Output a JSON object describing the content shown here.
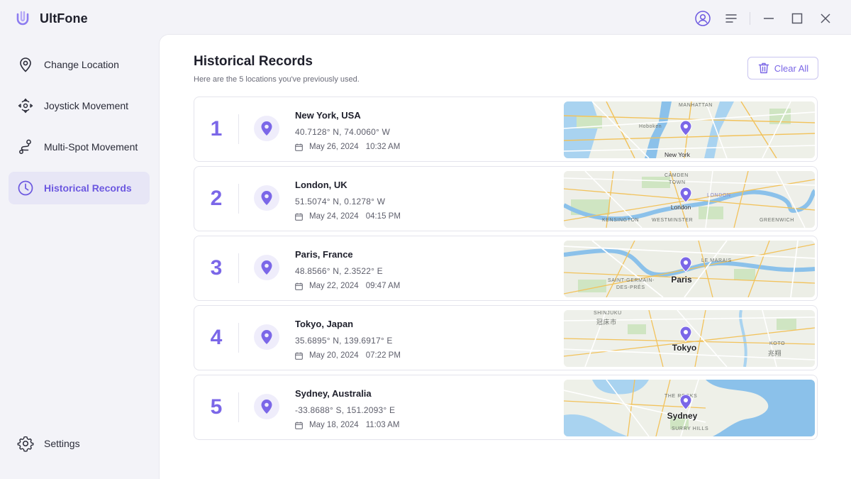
{
  "app": {
    "name": "UltFone",
    "brand_color": "#7b67e8"
  },
  "window_controls": {
    "icons": [
      "user-account-icon",
      "menu-icon",
      "minimize-icon",
      "maximize-icon",
      "close-icon"
    ]
  },
  "sidebar": {
    "items": [
      {
        "label": "Change Location",
        "icon": "location-pin-icon",
        "active": false
      },
      {
        "label": "Joystick Movement",
        "icon": "joystick-icon",
        "active": false
      },
      {
        "label": "Multi-Spot Movement",
        "icon": "route-icon",
        "active": false
      },
      {
        "label": "Historical Records",
        "icon": "clock-icon",
        "active": true
      }
    ],
    "settings_label": "Settings"
  },
  "main": {
    "title": "Historical Records",
    "subtitle": "Here are the 5 locations you've previously used.",
    "clear_all_label": "Clear All"
  },
  "records": [
    {
      "index": "1",
      "name": "New York, USA",
      "coords": "40.7128° N, 74.0060° W",
      "date": "May 26, 2024",
      "time": "10:32 AM",
      "map": {
        "city": "New York",
        "city_style": "small",
        "labels": [
          "MANHATTAN",
          "Hoboken"
        ]
      }
    },
    {
      "index": "2",
      "name": "London, UK",
      "coords": "51.5074° N, 0.1278° W",
      "date": "May 24, 2024",
      "time": "04:15 PM",
      "map": {
        "city": "London",
        "city_style": "small",
        "labels": [
          "CAMDEN",
          "TOWN",
          "LONDON",
          "KENSINGTON",
          "WESTMINSTER",
          "GREENWICH"
        ]
      }
    },
    {
      "index": "3",
      "name": "Paris, France",
      "coords": "48.8566° N, 2.3522° E",
      "date": "May 22, 2024",
      "time": "09:47 AM",
      "map": {
        "city": "Paris",
        "city_style": "large",
        "labels": [
          "LE MARAIS",
          "SAINT-GERMAIN-",
          "DES-PRÉS"
        ]
      }
    },
    {
      "index": "4",
      "name": "Tokyo, Japan",
      "coords": "35.6895° N, 139.6917° E",
      "date": "May 20, 2024",
      "time": "07:22 PM",
      "map": {
        "city": "Tokyo",
        "city_style": "large",
        "labels": [
          "SHINJUKU",
          "冠床市",
          "KOTO",
          "兆翔"
        ]
      }
    },
    {
      "index": "5",
      "name": "Sydney, Australia",
      "coords": "-33.8688° S, 151.2093° E",
      "date": "May 18, 2024",
      "time": "11:03 AM",
      "map": {
        "city": "Sydney",
        "city_style": "large",
        "labels": [
          "THE ROCKS",
          "SURRY HILLS"
        ]
      }
    }
  ]
}
